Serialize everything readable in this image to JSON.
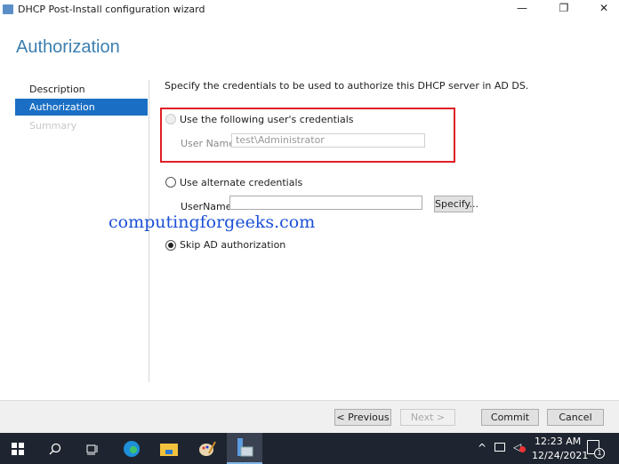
{
  "window": {
    "title": "DHCP Post-Install configuration wizard",
    "minimize": "—",
    "restore": "❐",
    "close": "✕"
  },
  "page": {
    "heading": "Authorization"
  },
  "nav": [
    {
      "label": "Description"
    },
    {
      "label": "Authorization"
    },
    {
      "label": "Summary"
    }
  ],
  "content": {
    "instruction": "Specify the credentials to be used to authorize this DHCP server in AD DS.",
    "option1": {
      "label": "Use the following user's credentials",
      "username_label": "User Name:",
      "username_value": "test\\Administrator"
    },
    "option2": {
      "label": "Use alternate credentials",
      "username_label": "UserName:",
      "username_value": "",
      "specify": "Specify..."
    },
    "option3": {
      "label": "Skip AD authorization"
    }
  },
  "watermark": "computingforgeeks.com",
  "footer": {
    "previous": "< Previous",
    "next": "Next >",
    "commit": "Commit",
    "cancel": "Cancel"
  },
  "taskbar": {
    "time": "12:23 AM",
    "date": "12/24/2021",
    "notifications": "1"
  }
}
